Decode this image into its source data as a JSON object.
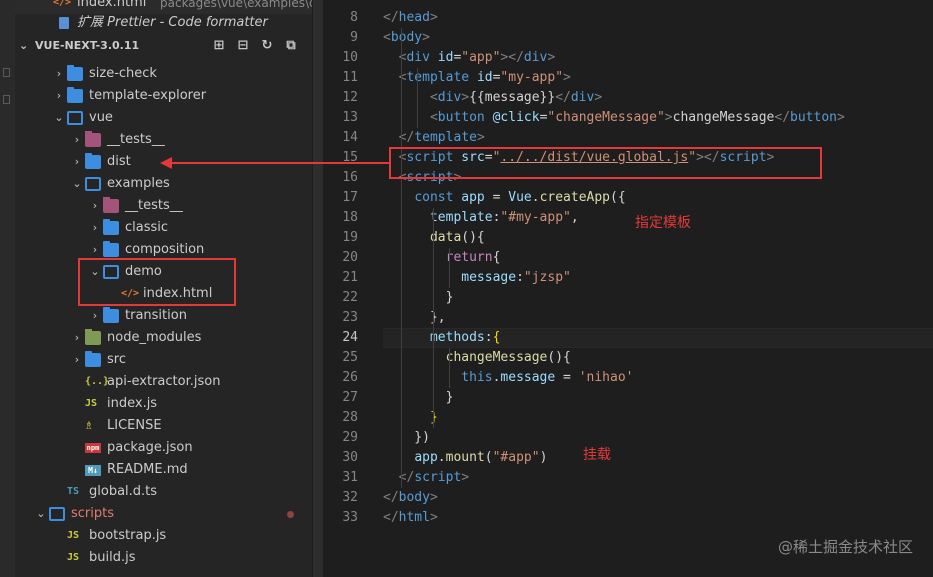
{
  "top_items": [
    {
      "icon": "</>",
      "label": "index.html",
      "detail": "packages\\vue\\examples\\demo"
    },
    {
      "label": "扩展 Prettier - Code formatter"
    }
  ],
  "explorer": {
    "title": "VUE-NEXT-3.0.11",
    "tree": [
      {
        "label": "size-check",
        "chev": "›",
        "type": "folder"
      },
      {
        "label": "template-explorer",
        "chev": "›",
        "type": "folder"
      },
      {
        "label": "vue",
        "chev": "⌄",
        "type": "folder-open"
      },
      {
        "label": "__tests__",
        "chev": "›",
        "type": "folder-tests"
      },
      {
        "label": "dist",
        "chev": "›",
        "type": "folder"
      },
      {
        "label": "examples",
        "chev": "⌄",
        "type": "folder-open"
      },
      {
        "label": "__tests__",
        "chev": "›",
        "type": "folder-tests"
      },
      {
        "label": "classic",
        "chev": "›",
        "type": "folder"
      },
      {
        "label": "composition",
        "chev": "›",
        "type": "folder"
      },
      {
        "label": "demo",
        "chev": "⌄",
        "type": "folder-open"
      },
      {
        "label": "index.html",
        "icon": "</>",
        "type": "html"
      },
      {
        "label": "transition",
        "chev": "›",
        "type": "folder"
      },
      {
        "label": "node_modules",
        "chev": "›",
        "type": "folder-nm"
      },
      {
        "label": "src",
        "chev": "›",
        "type": "folder"
      },
      {
        "label": "api-extractor.json",
        "icon": "{..}",
        "type": "json"
      },
      {
        "label": "index.js",
        "icon": "JS",
        "type": "js"
      },
      {
        "label": "LICENSE",
        "icon": "♗",
        "type": "license"
      },
      {
        "label": "package.json",
        "icon": "npm",
        "type": "pkg"
      },
      {
        "label": "README.md",
        "icon": "M↓",
        "type": "md"
      },
      {
        "label": "global.d.ts",
        "icon": "TS",
        "type": "ts"
      },
      {
        "label": "scripts",
        "chev": "⌄",
        "type": "folder-open"
      },
      {
        "label": "bootstrap.js",
        "icon": "JS",
        "type": "js"
      },
      {
        "label": "build.js",
        "icon": "JS",
        "type": "js"
      }
    ]
  },
  "editor": {
    "line_numbers": [
      "8",
      "9",
      "10",
      "11",
      "12",
      "13",
      "14",
      "15",
      "16",
      "17",
      "18",
      "19",
      "20",
      "21",
      "22",
      "23",
      "24",
      "25",
      "26",
      "27",
      "28",
      "29",
      "30",
      "31",
      "32",
      "33"
    ],
    "active_line": "24",
    "lines": [
      [
        [
          "t-br",
          "</"
        ],
        [
          "t-tag",
          "head"
        ],
        [
          "t-br",
          ">"
        ]
      ],
      [
        [
          "t-br",
          "<"
        ],
        [
          "t-tag",
          "body"
        ],
        [
          "t-br",
          ">"
        ]
      ],
      [
        [
          "t-plain",
          "  "
        ],
        [
          "t-br",
          "<"
        ],
        [
          "t-tag",
          "div"
        ],
        [
          "t-plain",
          " "
        ],
        [
          "t-attr",
          "id"
        ],
        [
          "t-plain",
          "="
        ],
        [
          "t-str",
          "\"app\""
        ],
        [
          "t-br",
          "></"
        ],
        [
          "t-tag",
          "div"
        ],
        [
          "t-br",
          ">"
        ]
      ],
      [
        [
          "t-plain",
          "  "
        ],
        [
          "t-br",
          "<"
        ],
        [
          "t-tag",
          "template"
        ],
        [
          "t-plain",
          " "
        ],
        [
          "t-attr",
          "id"
        ],
        [
          "t-plain",
          "="
        ],
        [
          "t-str",
          "\"my-app\""
        ],
        [
          "t-br",
          ">"
        ]
      ],
      [
        [
          "t-plain",
          "      "
        ],
        [
          "t-br",
          "<"
        ],
        [
          "t-tag",
          "div"
        ],
        [
          "t-br",
          ">"
        ],
        [
          "t-plain",
          "{{message}}"
        ],
        [
          "t-br",
          "</"
        ],
        [
          "t-tag",
          "div"
        ],
        [
          "t-br",
          ">"
        ]
      ],
      [
        [
          "t-plain",
          "      "
        ],
        [
          "t-br",
          "<"
        ],
        [
          "t-tag",
          "button"
        ],
        [
          "t-plain",
          " "
        ],
        [
          "t-attr",
          "@click"
        ],
        [
          "t-plain",
          "="
        ],
        [
          "t-str",
          "\"changeMessage\""
        ],
        [
          "t-br",
          ">"
        ],
        [
          "t-plain",
          "changeMessage"
        ],
        [
          "t-br",
          "</"
        ],
        [
          "t-tag",
          "button"
        ],
        [
          "t-br",
          ">"
        ]
      ],
      [
        [
          "t-plain",
          "  "
        ],
        [
          "t-br",
          "</"
        ],
        [
          "t-tag",
          "template"
        ],
        [
          "t-br",
          ">"
        ]
      ],
      [
        [
          "t-plain",
          "  "
        ],
        [
          "t-br",
          "<"
        ],
        [
          "t-tag",
          "script"
        ],
        [
          "t-plain",
          " "
        ],
        [
          "t-attr",
          "src"
        ],
        [
          "t-plain",
          "="
        ],
        [
          "t-str",
          "\""
        ],
        [
          "t-link",
          "../../dist/vue.global.js"
        ],
        [
          "t-str",
          "\""
        ],
        [
          "t-br",
          "></"
        ],
        [
          "t-tag",
          "script"
        ],
        [
          "t-br",
          ">"
        ]
      ],
      [
        [
          "t-plain",
          "  "
        ],
        [
          "t-br",
          "<"
        ],
        [
          "t-tag",
          "script"
        ],
        [
          "t-br",
          ">"
        ]
      ],
      [
        [
          "t-plain",
          "    "
        ],
        [
          "t-kw",
          "const"
        ],
        [
          "t-plain",
          " "
        ],
        [
          "t-var",
          "app"
        ],
        [
          "t-plain",
          " = "
        ],
        [
          "t-var",
          "Vue"
        ],
        [
          "t-plain",
          "."
        ],
        [
          "t-fn",
          "createApp"
        ],
        [
          "t-plain",
          "({"
        ]
      ],
      [
        [
          "t-plain",
          "      "
        ],
        [
          "t-var",
          "template"
        ],
        [
          "t-plain",
          ":"
        ],
        [
          "t-str",
          "\"#my-app\""
        ],
        [
          "t-plain",
          ","
        ]
      ],
      [
        [
          "t-plain",
          "      "
        ],
        [
          "t-fn",
          "data"
        ],
        [
          "t-plain",
          "(){"
        ]
      ],
      [
        [
          "t-plain",
          "        "
        ],
        [
          "t-ctl",
          "return"
        ],
        [
          "t-plain",
          "{"
        ]
      ],
      [
        [
          "t-plain",
          "          "
        ],
        [
          "t-var",
          "message"
        ],
        [
          "t-plain",
          ":"
        ],
        [
          "t-str",
          "\"jzsp\""
        ]
      ],
      [
        [
          "t-plain",
          "        }"
        ]
      ],
      [
        [
          "t-plain",
          "      },"
        ]
      ],
      [
        [
          "t-plain",
          "      "
        ],
        [
          "t-var",
          "methods"
        ],
        [
          "t-plain",
          ":"
        ],
        [
          "t-brk",
          "{"
        ]
      ],
      [
        [
          "t-plain",
          "        "
        ],
        [
          "t-fn",
          "changeMessage"
        ],
        [
          "t-plain",
          "(){"
        ]
      ],
      [
        [
          "t-plain",
          "          "
        ],
        [
          "t-kw",
          "this"
        ],
        [
          "t-plain",
          "."
        ],
        [
          "t-var",
          "message"
        ],
        [
          "t-plain",
          " = "
        ],
        [
          "t-str",
          "'nihao'"
        ]
      ],
      [
        [
          "t-plain",
          "        }"
        ]
      ],
      [
        [
          "t-plain",
          "      "
        ],
        [
          "t-brk",
          "}"
        ]
      ],
      [
        [
          "t-plain",
          "    })"
        ]
      ],
      [
        [
          "t-plain",
          "    "
        ],
        [
          "t-var",
          "app"
        ],
        [
          "t-plain",
          "."
        ],
        [
          "t-fn",
          "mount"
        ],
        [
          "t-plain",
          "("
        ],
        [
          "t-str",
          "\"#app\""
        ],
        [
          "t-plain",
          ")"
        ]
      ],
      [
        [
          "t-plain",
          "  "
        ],
        [
          "t-br",
          "</"
        ],
        [
          "t-tag",
          "script"
        ],
        [
          "t-br",
          ">"
        ]
      ],
      [
        [
          "t-br",
          "</"
        ],
        [
          "t-tag",
          "body"
        ],
        [
          "t-br",
          ">"
        ]
      ],
      [
        [
          "t-br",
          "</"
        ],
        [
          "t-tag",
          "html"
        ],
        [
          "t-br",
          ">"
        ]
      ]
    ]
  },
  "annotations": {
    "template_note": "指定模板",
    "mount_note": "挂载"
  },
  "watermark": "@稀土掘金技术社区",
  "colors": {
    "annotation": "#e23a3a",
    "folder": "#3d8ee0",
    "background": "#1e1e1e"
  }
}
